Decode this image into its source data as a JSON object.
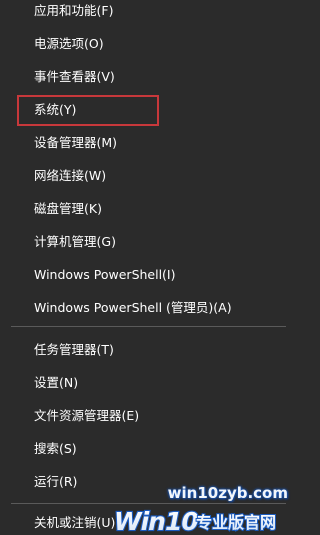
{
  "menu": {
    "items": [
      {
        "label": "应用和功能(F)"
      },
      {
        "label": "电源选项(O)"
      },
      {
        "label": "事件查看器(V)"
      },
      {
        "label": "系统(Y)"
      },
      {
        "label": "设备管理器(M)"
      },
      {
        "label": "网络连接(W)"
      },
      {
        "label": "磁盘管理(K)"
      },
      {
        "label": "计算机管理(G)"
      },
      {
        "label": "Windows PowerShell(I)"
      },
      {
        "label": "Windows PowerShell (管理员)(A)"
      },
      {
        "label": "任务管理器(T)"
      },
      {
        "label": "设置(N)"
      },
      {
        "label": "文件资源管理器(E)"
      },
      {
        "label": "搜索(S)"
      },
      {
        "label": "运行(R)"
      },
      {
        "label": "关机或注销(U)"
      }
    ]
  },
  "watermark": {
    "url": "win10zyb.com",
    "logo_text": "Win10 专业版官网"
  },
  "colors": {
    "menu_background": "#2b2b2b",
    "text": "#ffffff",
    "separator": "#5a5a5a",
    "highlight_border": "#c8383b",
    "watermark_blue": "#1b5bbf"
  }
}
